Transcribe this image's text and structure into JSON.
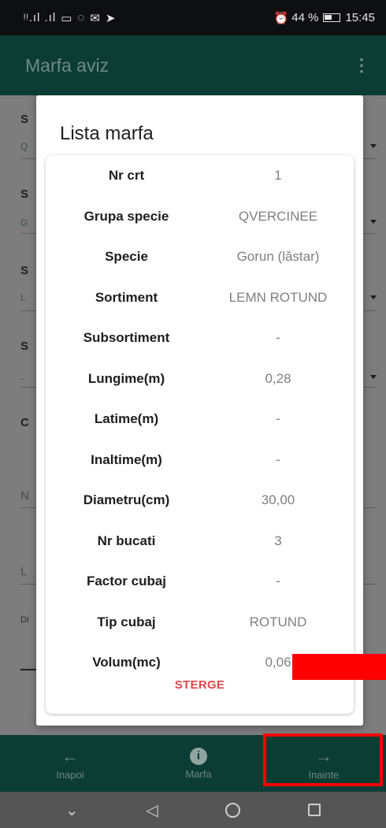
{
  "status_bar": {
    "signal_text": "ᵎᵎ.ıl .ıl",
    "icons": [
      "sim-icon",
      "whatsapp-icon",
      "mail-icon",
      "send-icon"
    ],
    "alarm_icon": "alarm-icon",
    "battery_percent": "44 %",
    "time": "15:45"
  },
  "app_bar": {
    "title": "Marfa aviz",
    "menu_icon": "⋮"
  },
  "background_form": {
    "rows": [
      {
        "label": "S",
        "value": "Q"
      },
      {
        "label": "S",
        "value": "G"
      },
      {
        "label": "S",
        "value": "L"
      },
      {
        "label": "S",
        "value": "-"
      },
      {
        "label": "C",
        "value": ""
      },
      {
        "label": "N",
        "value": ""
      },
      {
        "label": "L",
        "value": ""
      },
      {
        "label": "Di",
        "value": ""
      }
    ]
  },
  "dialog": {
    "title": "Lista marfa",
    "rows": [
      {
        "label": "Nr crt",
        "value": "1"
      },
      {
        "label": "Grupa specie",
        "value": "QVERCINEE"
      },
      {
        "label": "Specie",
        "value": "Gorun (lăstar)"
      },
      {
        "label": "Sortiment",
        "value": "LEMN ROTUND"
      },
      {
        "label": "Subsortiment",
        "value": "-"
      },
      {
        "label": "Lungime(m)",
        "value": "0,28"
      },
      {
        "label": "Latime(m)",
        "value": "-"
      },
      {
        "label": "Inaltime(m)",
        "value": "-"
      },
      {
        "label": "Diametru(cm)",
        "value": "30,00"
      },
      {
        "label": "Nr bucati",
        "value": "3"
      },
      {
        "label": "Factor cubaj",
        "value": "-"
      },
      {
        "label": "Tip cubaj",
        "value": "ROTUND"
      },
      {
        "label": "Volum(mc)",
        "value": "0,06"
      }
    ],
    "delete_label": "STERGE"
  },
  "bottom_nav": {
    "back": {
      "icon": "←",
      "label": "Inapoi"
    },
    "info": {
      "icon": "i",
      "label": "Marfa"
    },
    "next": {
      "icon": "→",
      "label": "Inainte"
    }
  },
  "system_nav": {
    "back": "◁",
    "collapse": "⌄"
  },
  "colors": {
    "app_bar": "#0b3d35",
    "delete": "#e0464a",
    "annotation": "#ff0000"
  }
}
